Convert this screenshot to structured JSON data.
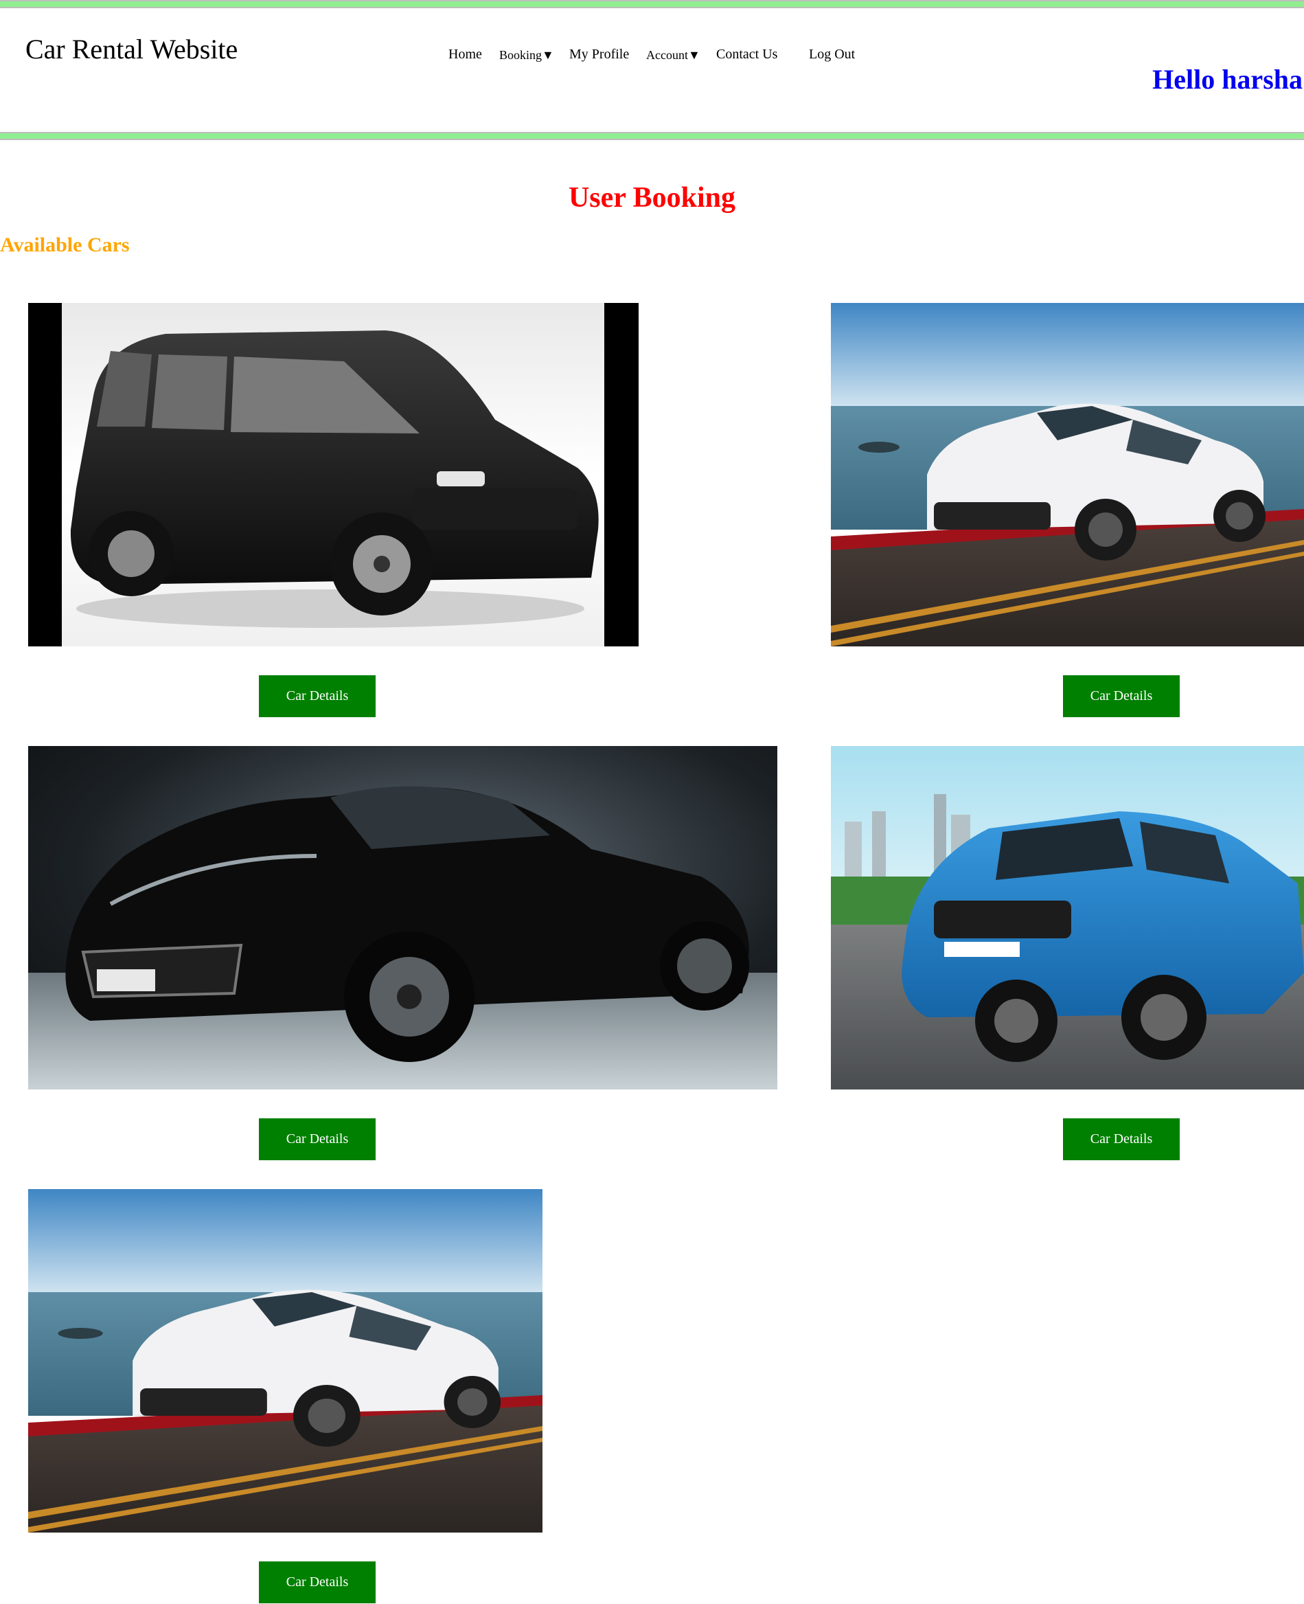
{
  "header": {
    "site_title": "Car Rental Website",
    "greeting": "Hello harsha",
    "accent_color": "#90ee90"
  },
  "nav": {
    "home": "Home",
    "booking": "Booking",
    "my_profile": "My Profile",
    "account": "Account",
    "contact_us": "Contact Us",
    "log_out": "Log Out",
    "dropdown_caret": "▼"
  },
  "main": {
    "page_heading": "User Booking",
    "section_heading": "Available Cars",
    "heading_color": "#ff0000",
    "section_color": "#ffa500"
  },
  "cars": [
    {
      "image": "black-mpv-photo",
      "button_label": "Car Details"
    },
    {
      "image": "white-sedan-seaside-photo",
      "button_label": "Car Details"
    },
    {
      "image": "black-sports-car-photo",
      "button_label": "Car Details"
    },
    {
      "image": "blue-suv-photo",
      "button_label": "Car Details"
    },
    {
      "image": "white-sedan-seaside-photo",
      "button_label": "Car Details"
    }
  ],
  "button_color": "#008000"
}
